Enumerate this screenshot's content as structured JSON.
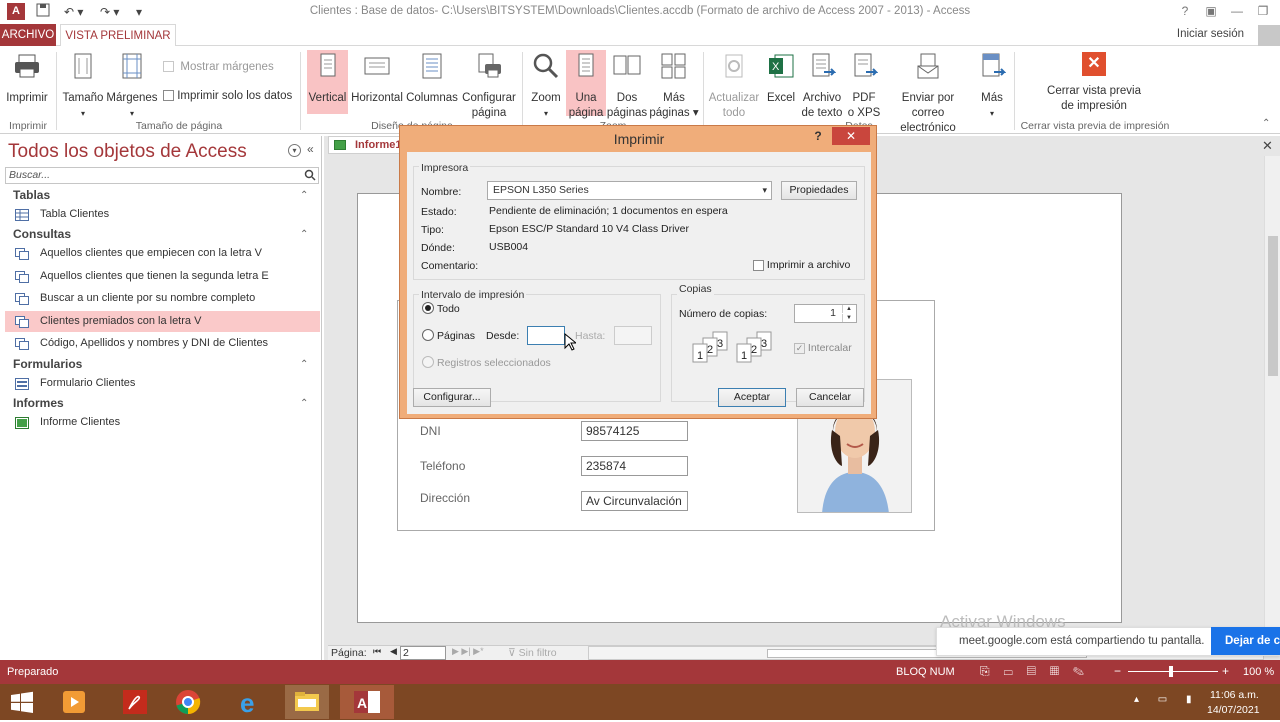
{
  "window": {
    "title": "Clientes : Base de datos- C:\\Users\\BITSYSTEM\\Downloads\\Clientes.accdb (Formato de archivo de Access 2007 - 2013) - Access"
  },
  "tabs": {
    "archivo": "ARCHIVO",
    "vista_preliminar": "VISTA PRELIMINAR",
    "signin": "Iniciar sesión"
  },
  "ribbon": {
    "imprimir": "Imprimir",
    "tamano": "Tamaño",
    "margenes": "Márgenes",
    "mostrar_margenes": "Mostrar márgenes",
    "imprimir_solo_datos": "Imprimir solo los datos",
    "vertical": "Vertical",
    "horizontal": "Horizontal",
    "columnas": "Columnas",
    "configurar_1": "Configurar",
    "configurar_2": "página",
    "zoom": "Zoom",
    "una_1": "Una",
    "una_2": "página",
    "dos_1": "Dos",
    "dos_2": "páginas",
    "mas_1": "Más",
    "mas_2": "páginas",
    "actualizar_1": "Actualizar",
    "actualizar_2": "todo",
    "excel": "Excel",
    "archivo_1": "Archivo",
    "archivo_2": "de texto",
    "pdf_1": "PDF",
    "pdf_2": "o XPS",
    "enviar_1": "Enviar por correo",
    "enviar_2": "electrónico",
    "mas": "Más",
    "cerrar_1": "Cerrar vista previa",
    "cerrar_2": "de impresión",
    "grp_imprimir": "Imprimir",
    "grp_tamano": "Tamaño de página",
    "grp_diseno": "Diseño de página",
    "grp_zoom": "Zoom",
    "grp_datos": "Datos",
    "grp_cerrar": "Cerrar vista previa de impresión"
  },
  "nav": {
    "title": "Todos los objetos de Access",
    "search_placeholder": "Buscar...",
    "categories": {
      "tablas": "Tablas",
      "consultas": "Consultas",
      "formularios": "Formularios",
      "informes": "Informes"
    },
    "items": {
      "tabla_clientes": "Tabla Clientes",
      "q1": "Aquellos clientes que empiecen con la letra V",
      "q2": "Aquellos clientes que tienen la segunda letra E",
      "q3": "Buscar a un cliente por su nombre completo",
      "q4": "Clientes premiados con la letra V",
      "q5": "Código, Apellidos y nombres y DNI de Clientes",
      "formulario_clientes": "Formulario Clientes",
      "informe_clientes": "Informe Clientes"
    }
  },
  "doc": {
    "tab": "Informe1",
    "fields": {
      "dni_label": "DNI",
      "dni_value": "98574125",
      "telefono_label": "Teléfono",
      "telefono_value": "235874",
      "direccion_label": "Dirección",
      "direccion_value": "Av Circunvalación"
    },
    "pager": {
      "label": "Página:",
      "value": "2",
      "filter": "Sin filtro"
    }
  },
  "dialog": {
    "title": "Imprimir",
    "help": "?",
    "impresora": "Impresora",
    "nombre_label": "Nombre:",
    "nombre_value": "EPSON L350 Series",
    "propiedades": "Propiedades",
    "estado_label": "Estado:",
    "estado_value": "Pendiente de eliminación; 1 documentos en espera",
    "tipo_label": "Tipo:",
    "tipo_value": "Epson ESC/P Standard 10 V4 Class Driver",
    "donde_label": "Dónde:",
    "donde_value": "USB004",
    "comentario_label": "Comentario:",
    "imprimir_archivo": "Imprimir a archivo",
    "intervalo": "Intervalo de impresión",
    "todo": "Todo",
    "paginas": "Páginas",
    "desde": "Desde:",
    "hasta": "Hasta:",
    "registros": "Registros seleccionados",
    "copias": "Copias",
    "num_copias_label": "Número de copias:",
    "num_copias_value": "1",
    "intercalar": "Intercalar",
    "configurar": "Configurar...",
    "aceptar": "Aceptar",
    "cancelar": "Cancelar"
  },
  "watermark": {
    "line1": "Activar Windows",
    "share": "meet.google.com está compartiendo tu pantalla.",
    "stop": "Dejar de c"
  },
  "status": {
    "left": "Preparado",
    "bloq": "BLOQ NUM",
    "zoom": "100 %"
  },
  "taskbar": {
    "time": "11:06 a.m.",
    "date": "14/07/2021"
  },
  "colors": {
    "accent": "#a4373a",
    "dialog_frame": "#f0ad7a",
    "selected": "#fac9c9"
  }
}
